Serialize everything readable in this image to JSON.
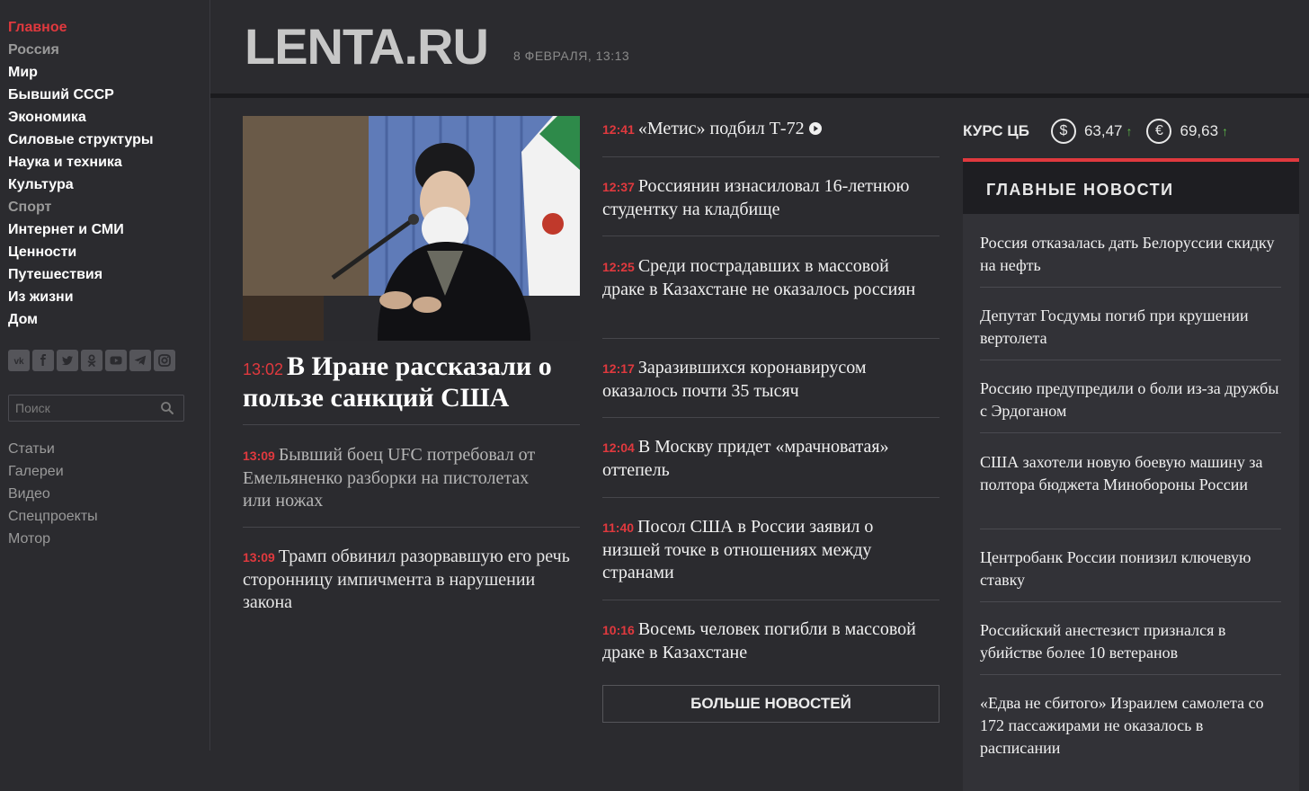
{
  "nav": {
    "items": [
      {
        "label": "Главное",
        "state": "active"
      },
      {
        "label": "Россия",
        "state": "muted"
      },
      {
        "label": "Мир",
        "state": ""
      },
      {
        "label": "Бывший СССР",
        "state": ""
      },
      {
        "label": "Экономика",
        "state": ""
      },
      {
        "label": "Силовые структуры",
        "state": ""
      },
      {
        "label": "Наука и техника",
        "state": ""
      },
      {
        "label": "Культура",
        "state": ""
      },
      {
        "label": "Спорт",
        "state": "muted"
      },
      {
        "label": "Интернет и СМИ",
        "state": ""
      },
      {
        "label": "Ценности",
        "state": ""
      },
      {
        "label": "Путешествия",
        "state": ""
      },
      {
        "label": "Из жизни",
        "state": ""
      },
      {
        "label": "Дом",
        "state": ""
      }
    ],
    "socials": [
      "vk-icon",
      "facebook-icon",
      "twitter-icon",
      "odnoklassniki-icon",
      "youtube-icon",
      "telegram-icon",
      "instagram-icon"
    ],
    "search_placeholder": "Поиск",
    "sublinks": [
      "Статьи",
      "Галереи",
      "Видео",
      "Спецпроекты",
      "Мотор"
    ]
  },
  "header": {
    "logo": "LENTA.RU",
    "date": "8 ФЕВРАЛЯ, 13:13"
  },
  "lead": {
    "time": "13:02",
    "title": "В Иране рассказали о пользе санкций США"
  },
  "left_stories": [
    {
      "time": "13:09",
      "title": "Бывший боец UFC потребовал от Емельяненко разборки на пистолетах или ножах"
    },
    {
      "time": "13:09",
      "title": "Трамп обвинил разорвавшую его речь сторонницу импичмента в нарушении закона"
    }
  ],
  "news_feed": [
    {
      "time": "12:41",
      "title": "«Метис» подбил Т-72",
      "video": true
    },
    {
      "time": "12:37",
      "title": "Россиянин изнасиловал 16-летнюю студентку на кладбище"
    },
    {
      "time": "12:25",
      "title": "Среди пострадавших в массовой драке в Казахстане не оказалось россиян"
    },
    {
      "time": "12:17",
      "title": "Заразившихся коронавирусом оказалось почти 35 тысяч"
    },
    {
      "time": "12:04",
      "title": "В Москву придет «мрачноватая» оттепель"
    },
    {
      "time": "11:40",
      "title": "Посол США в России заявил о низшей точке в отношениях между странами"
    },
    {
      "time": "10:16",
      "title": "Восемь человек погибли в массовой драке в Казахстане"
    }
  ],
  "more_button": "БОЛЬШЕ НОВОСТЕЙ",
  "rates": {
    "label": "КУРС ЦБ",
    "usd": {
      "symbol": "$",
      "value": "63,47",
      "trend": "↑"
    },
    "eur": {
      "symbol": "€",
      "value": "69,63",
      "trend": "↑"
    },
    "trend_color": "#5fbf4a"
  },
  "top_news": {
    "heading": "ГЛАВНЫЕ НОВОСТИ",
    "items": [
      "Россия отказалась дать Белоруссии скидку на нефть",
      "Депутат Госдумы погиб при крушении вертолета",
      "Россию предупредили о боли из-за дружбы с Эрдоганом",
      "США захотели новую боевую машину за полтора бюджета Минобороны России",
      "Центробанк России понизил ключевую ставку",
      "Российский анестезист признался в убийстве более 10 ветеранов",
      "«Едва не сбитого» Израилем самолета со 172 пассажирами не оказалось в расписании"
    ]
  },
  "colors": {
    "accent": "#e0393e",
    "background": "#2b2b2f",
    "panel": "#323237"
  }
}
